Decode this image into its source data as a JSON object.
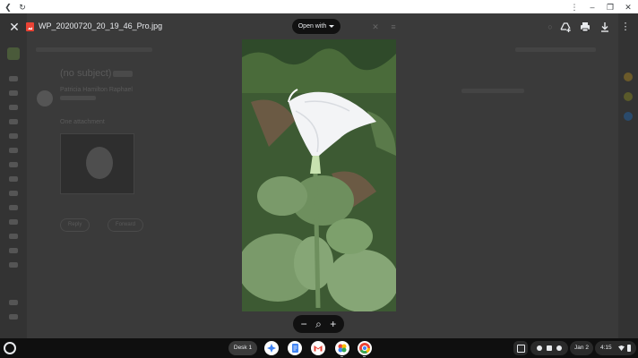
{
  "browser": {
    "back_icon": "chevron-left-icon",
    "reload_icon": "reload-icon",
    "menu_icon": "more-vertical-icon",
    "minimize_icon": "minimize-icon",
    "restore_icon": "restore-icon",
    "close_icon": "close-icon"
  },
  "viewer": {
    "filename": "WP_20200720_20_19_46_Pro.jpg",
    "open_with_label": "Open with",
    "icons": {
      "close": "close-icon",
      "file_type": "image-file-icon",
      "add_to_drive": "add-to-drive-icon",
      "print": "print-icon",
      "download": "download-icon",
      "more": "more-vertical-icon"
    }
  },
  "zoom": {
    "zoom_out_glyph": "−",
    "zoom_icon_glyph": "⌕",
    "zoom_in_glyph": "+"
  },
  "gmail_background": {
    "subject": "(no subject)",
    "sender": "Patricia Hamilton Raphael",
    "attachment_label": "One attachment",
    "reply_label": "Reply",
    "forward_label": "Forward"
  },
  "shelf": {
    "desk_label": "Desk 1",
    "date_label": "Jan 2",
    "time_label": "4:15",
    "apps": [
      "assistant",
      "docs",
      "gmail",
      "photos",
      "chrome"
    ]
  },
  "colors": {
    "viewer_overlay": "#1d1d1d",
    "gmail_red": "#ea4335",
    "text": "#e8eaed"
  }
}
